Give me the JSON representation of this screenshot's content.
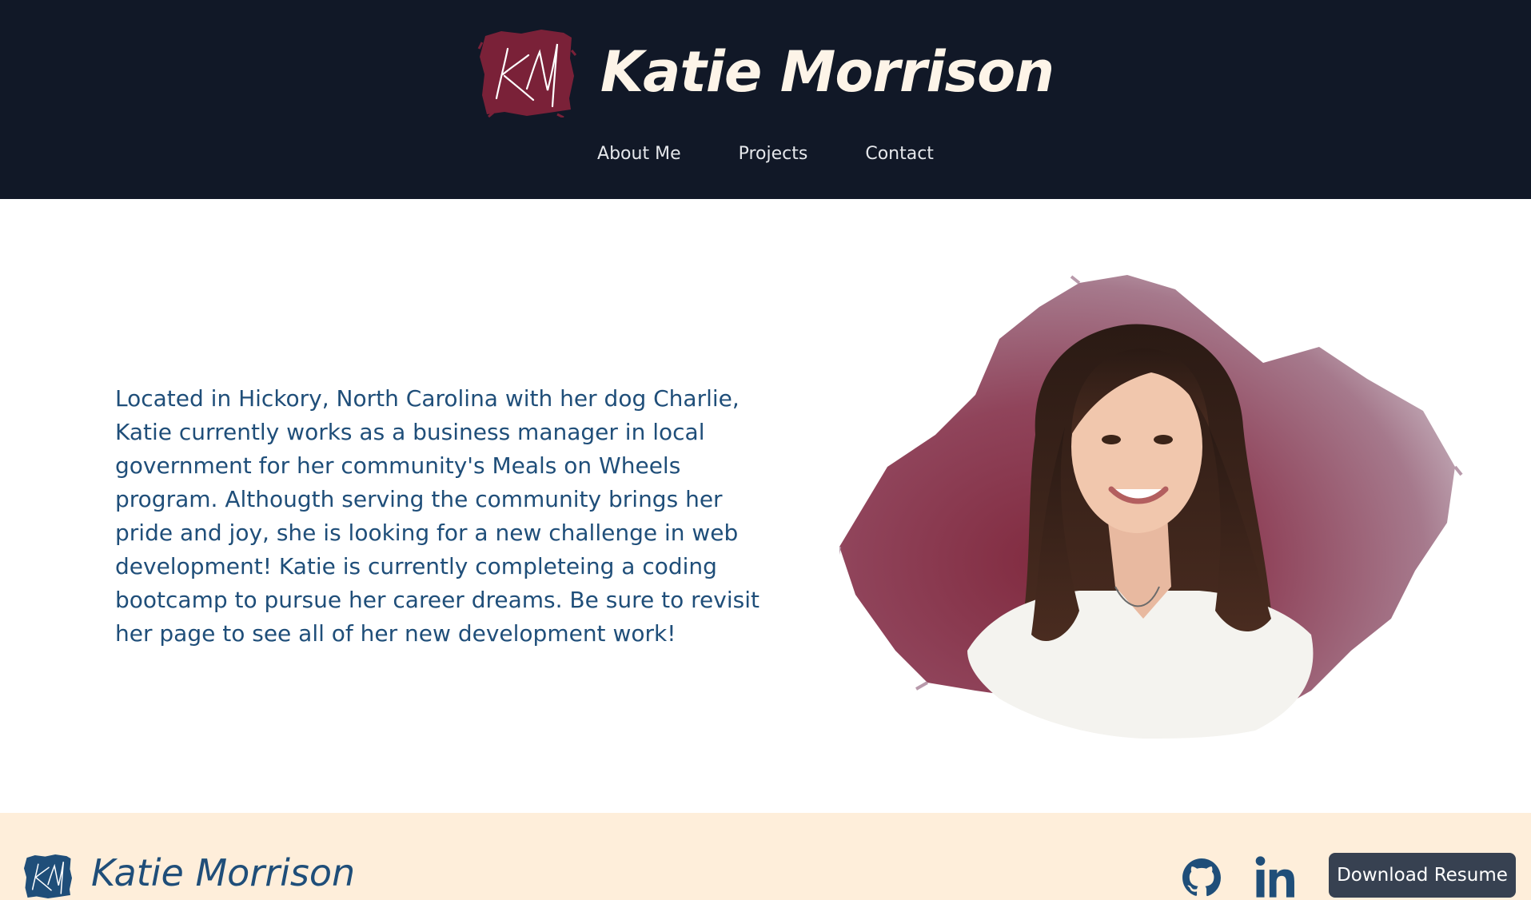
{
  "header": {
    "logo_initials": "KM",
    "site_title": "Katie Morrison",
    "nav": [
      "About Me",
      "Projects",
      "Contact"
    ]
  },
  "about": {
    "text": "Located in Hickory, North Carolina with her dog Charlie, Katie currently works as a business manager in local government for her community's Meals on Wheels program. Althougth serving the community brings her pride and joy, she is looking for a new challenge in web development! Katie is currently completeing a coding bootcamp to pursue her career dreams. Be sure to revisit her page to see all of her new development work!"
  },
  "footer": {
    "site_title": "Katie Morrison",
    "resume_label": "Download Resume",
    "social_icons": [
      "github-icon",
      "linkedin-icon"
    ]
  },
  "colors": {
    "header_bg": "#111827",
    "accent_maroon": "#7a2138",
    "title_cream": "#fdf4e8",
    "text_blue": "#1f4e79",
    "footer_bg": "#feeeda",
    "button_bg": "#374151"
  }
}
